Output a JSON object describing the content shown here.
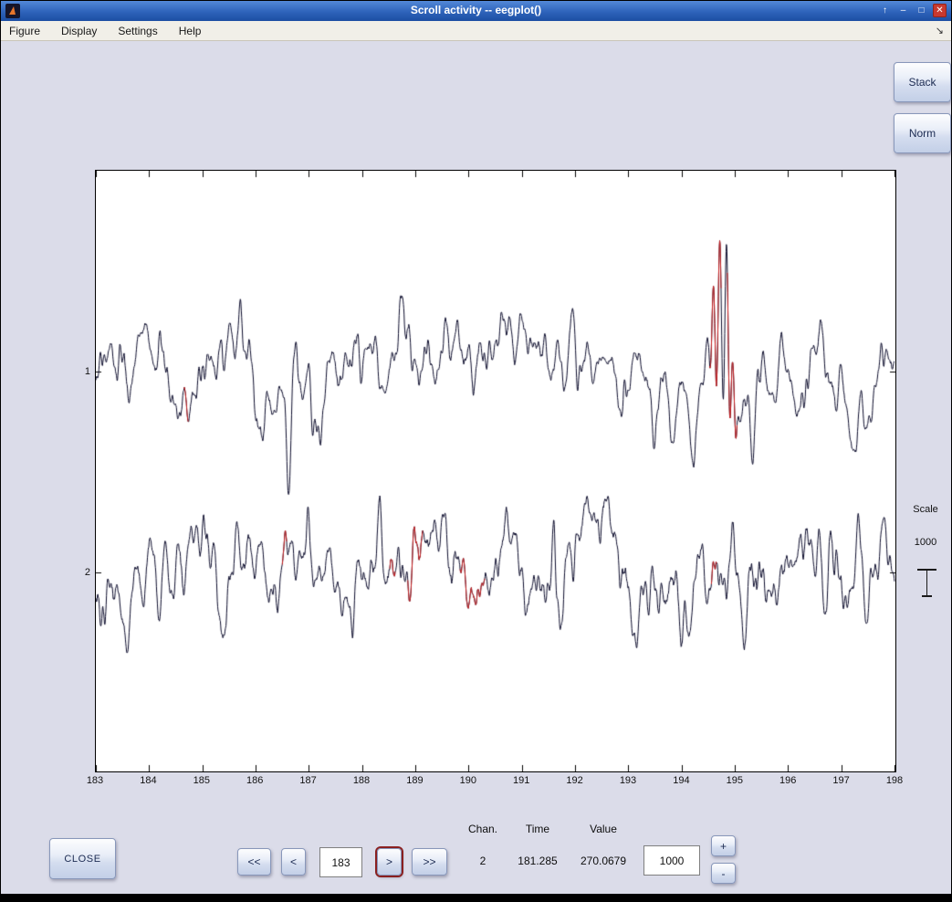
{
  "window": {
    "title": "Scroll activity -- eegplot()",
    "icons": {
      "shade": "↑",
      "minimize": "–",
      "maximize": "□",
      "close": "✕",
      "dock": "↘"
    }
  },
  "menu": {
    "items": [
      "Figure",
      "Display",
      "Settings",
      "Help"
    ]
  },
  "toolbar": {
    "stack": "Stack",
    "norm": "Norm"
  },
  "controls": {
    "close": "CLOSE",
    "fast_back": "<<",
    "back": "<",
    "forward": ">",
    "fast_forward": ">>",
    "time_field": "183",
    "scale_field": "1000",
    "scale_up": "+",
    "scale_down": "-"
  },
  "status": {
    "chan_label": "Chan.",
    "time_label": "Time",
    "value_label": "Value",
    "chan_value": "2",
    "time_value": "181.285",
    "value_value": "270.0679"
  },
  "scale_indicator": {
    "label": "Scale",
    "value": "1000"
  },
  "chart_data": {
    "type": "line",
    "title": "",
    "xlabel": "",
    "ylabel": "",
    "x_range": [
      183,
      198
    ],
    "x_ticks": [
      "183",
      "184",
      "185",
      "186",
      "187",
      "188",
      "189",
      "190",
      "191",
      "192",
      "193",
      "194",
      "195",
      "196",
      "197",
      "198"
    ],
    "line_color": "#0b0b2b",
    "highlight_color": "#cc2222",
    "grid": false,
    "channels": [
      {
        "label": "1",
        "events": [
          {
            "type": "spike",
            "t": 185.62,
            "w": 0.05,
            "a": 55
          },
          {
            "type": "spike",
            "t": 186.62,
            "w": 0.055,
            "a": 105
          },
          {
            "type": "spike",
            "t": 190.08,
            "w": 0.05,
            "a": 45
          },
          {
            "type": "spike",
            "t": 192.32,
            "w": 0.05,
            "a": 40
          },
          {
            "type": "spike",
            "t": 194.22,
            "w": 0.05,
            "a": 55
          },
          {
            "type": "burst",
            "t0": 194.5,
            "t1": 195.06,
            "f": 8.0,
            "a": 90,
            "o": -80
          },
          {
            "type": "spike",
            "t": 195.33,
            "w": 0.06,
            "a": 115
          }
        ],
        "highlights": [
          [
            184.66,
            184.74
          ],
          [
            194.53,
            194.74
          ],
          [
            194.86,
            195.04
          ]
        ]
      },
      {
        "label": "2",
        "events": [
          {
            "type": "spike",
            "t": 187.0,
            "w": 0.05,
            "a": -62
          },
          {
            "type": "spike",
            "t": 188.33,
            "w": 0.05,
            "a": -55
          },
          {
            "type": "spike",
            "t": 189.97,
            "w": 0.05,
            "a": 58
          },
          {
            "type": "spike",
            "t": 190.72,
            "w": 0.04,
            "a": -58
          },
          {
            "type": "spike",
            "t": 191.62,
            "w": 0.05,
            "a": -50
          },
          {
            "type": "spike",
            "t": 194.95,
            "w": 0.06,
            "a": -68
          },
          {
            "type": "spike",
            "t": 195.18,
            "w": 0.05,
            "a": 70
          },
          {
            "type": "spike",
            "t": 197.3,
            "w": 0.06,
            "a": -55
          }
        ],
        "highlights": [
          [
            186.5,
            186.58
          ],
          [
            188.52,
            188.62
          ],
          [
            188.86,
            189.14
          ],
          [
            189.84,
            190.3
          ],
          [
            194.56,
            194.66
          ]
        ]
      }
    ]
  }
}
